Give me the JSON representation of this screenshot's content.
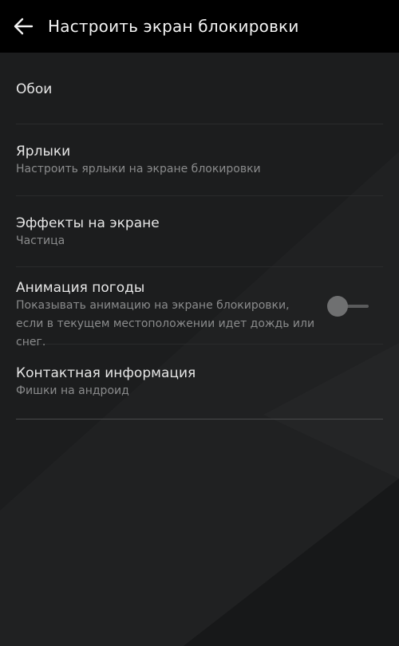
{
  "appbar": {
    "title": "Настроить экран блокировки",
    "back_icon": "arrow-left-icon"
  },
  "settings": [
    {
      "title": "Обои",
      "subtitle": ""
    },
    {
      "title": "Ярлыки",
      "subtitle": "Настроить ярлыки на экране блокировки"
    },
    {
      "title": "Эффекты на экране",
      "subtitle": "Частица"
    },
    {
      "title": "Анимация погоды",
      "subtitle": "Показывать анимацию на экране блокировки, если в текущем местоположении идет дождь или снег.",
      "toggle_on": false
    },
    {
      "title": "Контактная информация",
      "subtitle": "Фишки на андроид"
    }
  ],
  "colors": {
    "appbar_bg": "#000000",
    "screen_bg": "#1c1d1e",
    "title_text": "#e6e6e6",
    "subtitle_text": "#8a8b8c"
  }
}
